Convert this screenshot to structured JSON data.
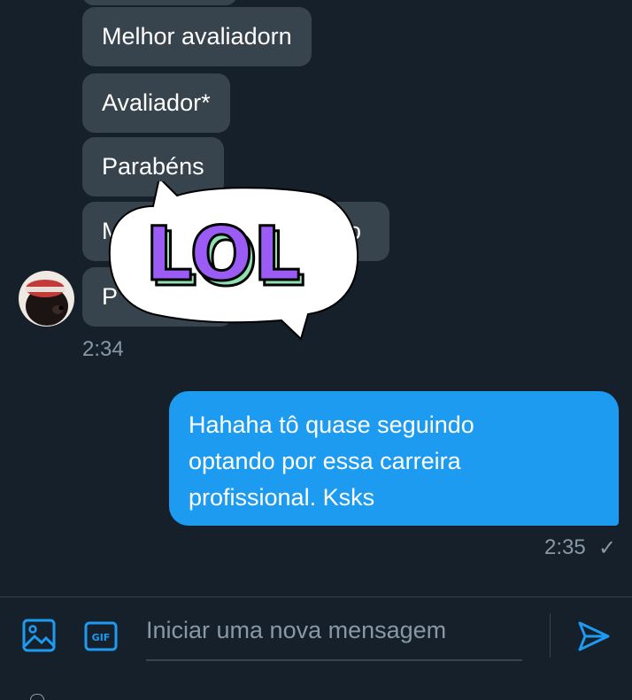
{
  "incoming": {
    "messages": [
      "Melhor avaliadorn",
      "Avaliador*",
      "Parabéns",
      "M",
      "P"
    ],
    "hidden_tail_text": "o",
    "time": "2:34"
  },
  "sticker": {
    "text": "LOL",
    "fill_color": "#9b5cf6",
    "shade_color": "#8de0b0"
  },
  "outgoing": {
    "lines": [
      "Hahaha tô quase seguindo",
      "optando por essa carreira",
      "profissional. Ksks"
    ],
    "time": "2:35",
    "status": "✓"
  },
  "composer": {
    "placeholder": "Iniciar uma nova mensagem",
    "gif_label": "GIF",
    "icons": [
      "image-icon",
      "gif-icon",
      "send-icon"
    ]
  },
  "colors": {
    "background": "#15202b",
    "incoming_bubble": "#38444d",
    "outgoing_bubble": "#1d9bf0",
    "accent": "#1d9bf0",
    "muted": "#8899a6"
  }
}
